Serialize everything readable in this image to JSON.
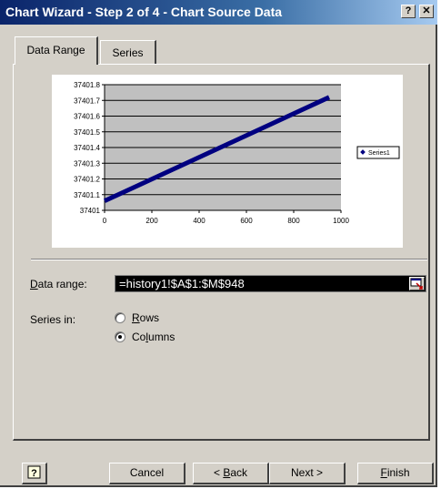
{
  "window": {
    "title": "Chart Wizard - Step 2 of 4 - Chart Source Data",
    "help_glyph": "?",
    "close_glyph": "✕"
  },
  "tabs": [
    {
      "label": "Data Range",
      "active": true
    },
    {
      "label": "Series",
      "active": false
    }
  ],
  "chart_data": {
    "type": "line",
    "x": [
      0,
      950
    ],
    "series": [
      {
        "name": "Series1",
        "values": [
          37401.06,
          37401.72
        ]
      }
    ],
    "xlim": [
      0,
      1000
    ],
    "ylim": [
      37401,
      37401.8
    ],
    "x_ticks": [
      "0",
      "200",
      "400",
      "600",
      "800",
      "1000"
    ],
    "y_ticks": [
      "37401",
      "37401.1",
      "37401.2",
      "37401.3",
      "37401.4",
      "37401.5",
      "37401.6",
      "37401.7",
      "37401.8"
    ],
    "grid": true,
    "legend_position": "right",
    "colors": {
      "series": "#000080",
      "plot_area": "#c0c0c0"
    }
  },
  "data_range": {
    "label_pre": "",
    "label_u": "D",
    "label_post": "ata range:",
    "value": "=history1!$A$1:$M$948"
  },
  "series_in": {
    "label": "Series in:",
    "options": [
      {
        "pre": "",
        "u": "R",
        "post": "ows",
        "selected": false
      },
      {
        "pre": "Co",
        "u": "l",
        "post": "umns",
        "selected": true
      }
    ]
  },
  "buttons": {
    "cancel": {
      "pre": "Cancel",
      "u": "",
      "post": ""
    },
    "back": {
      "pre": "< ",
      "u": "B",
      "post": "ack"
    },
    "next": {
      "pre": "Next >",
      "u": "",
      "post": ""
    },
    "finish": {
      "pre": "",
      "u": "F",
      "post": "inish"
    }
  },
  "icons": {
    "title_help": "help-icon",
    "title_close": "close-icon",
    "wizard_help": "office-assistant-help-icon",
    "collapse": "collapse-dialog-icon"
  },
  "colors": {
    "title_start": "#0a246a",
    "title_end": "#a6caf0",
    "dialog_bg": "#d4d0c8"
  }
}
